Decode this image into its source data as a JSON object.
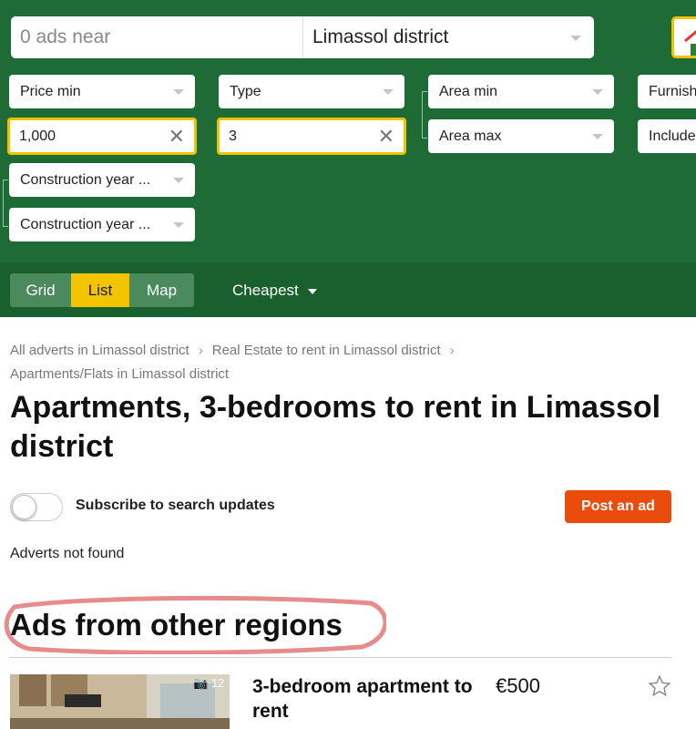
{
  "search": {
    "query_placeholder": "0 ads near",
    "region": "Limassol district"
  },
  "filters": {
    "price_min": "Price min",
    "price_value": "1,000",
    "type": "Type",
    "type_value": "3",
    "area_min": "Area min",
    "area_max": "Area max",
    "furnishing": "Furnish",
    "include": "Include",
    "construction_from": "Construction year ...",
    "construction_to": "Construction year ..."
  },
  "view": {
    "options": [
      "Grid",
      "List",
      "Map"
    ],
    "selected": "List",
    "sort": "Cheapest"
  },
  "breadcrumbs": [
    "All adverts in Limassol district",
    "Real Estate to rent in Limassol district",
    "Apartments/Flats in Limassol district"
  ],
  "page_title": "Apartments, 3-bedrooms to rent in Limassol district",
  "subscribe": {
    "label": "Subscribe to search updates",
    "enabled": false
  },
  "post_ad": "Post an ad",
  "status": "Adverts not found",
  "other_regions_title": "Ads from other regions",
  "listing": {
    "photo_count": "12",
    "title": "3-bedroom apartment to rent",
    "price": "€500"
  },
  "colors": {
    "panel": "#1f6b35",
    "accent_yellow": "#f5c400",
    "post_button": "#ea4c0c",
    "highlight_circle": "#e58c8c"
  }
}
